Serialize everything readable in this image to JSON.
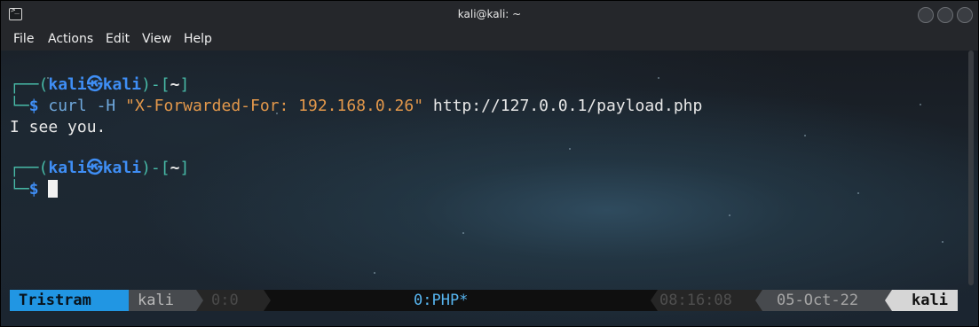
{
  "window": {
    "title": "kali@kali: ~",
    "icon": "terminal-icon"
  },
  "menu": [
    "File",
    "Actions",
    "Edit",
    "View",
    "Help"
  ],
  "terminal": {
    "prompt1": {
      "open": "┌──(",
      "user": "kali",
      "at": "㉿",
      "host": "kali",
      "mid": ")-[",
      "dir": "~",
      "close": "]"
    },
    "cmd1": {
      "corner": "└─",
      "dollar": "$",
      "command": "curl",
      "flag": "-H",
      "header": "\"X-Forwarded-For: 192.168.0.26\"",
      "url": "http://127.0.0.1/payload.php"
    },
    "output": "I see you.",
    "prompt2": {
      "open": "┌──(",
      "user": "kali",
      "at": "㉿",
      "host": "kali",
      "mid": ")-[",
      "dir": "~",
      "close": "]"
    },
    "cmd2": {
      "corner": "└─",
      "dollar": "$"
    }
  },
  "status_bar": {
    "session": "Tristram",
    "user": "kali",
    "pane": "0:0",
    "window": "0:PHP*",
    "time": "08:16:08",
    "date": "05-Oct-22",
    "host": "kali"
  },
  "colors": {
    "accent_blue": "#2196e3",
    "prompt_green": "#47b9a6",
    "prompt_blue": "#3f8ef5",
    "string_orange": "#e3984b"
  }
}
